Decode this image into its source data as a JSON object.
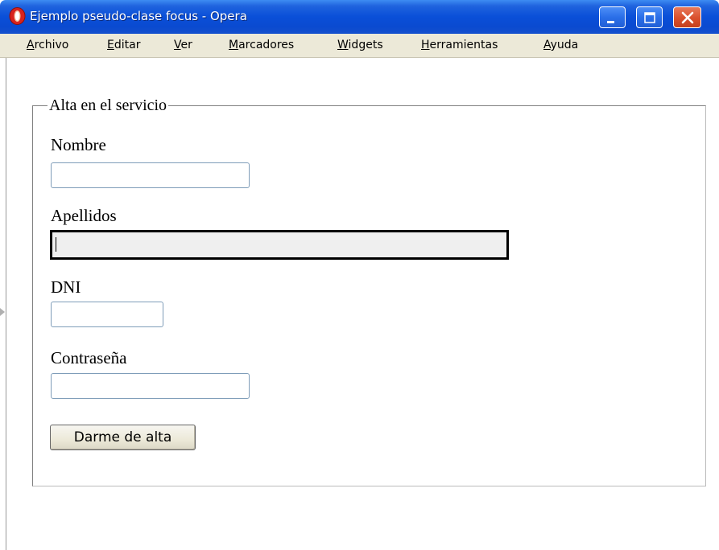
{
  "window": {
    "title": "Ejemplo pseudo-clase focus - Opera",
    "icon": "opera-icon"
  },
  "menu": {
    "items": [
      "Archivo",
      "Editar",
      "Ver",
      "Marcadores",
      "Widgets",
      "Herramientas",
      "Ayuda"
    ]
  },
  "form": {
    "legend": "Alta en el servicio",
    "fields": [
      {
        "label": "Nombre",
        "value": "",
        "focused": false
      },
      {
        "label": "Apellidos",
        "value": "",
        "focused": true
      },
      {
        "label": "DNI",
        "value": "",
        "focused": false
      },
      {
        "label": "Contraseña",
        "value": "",
        "focused": false
      }
    ],
    "submit_label": "Darme de alta"
  }
}
